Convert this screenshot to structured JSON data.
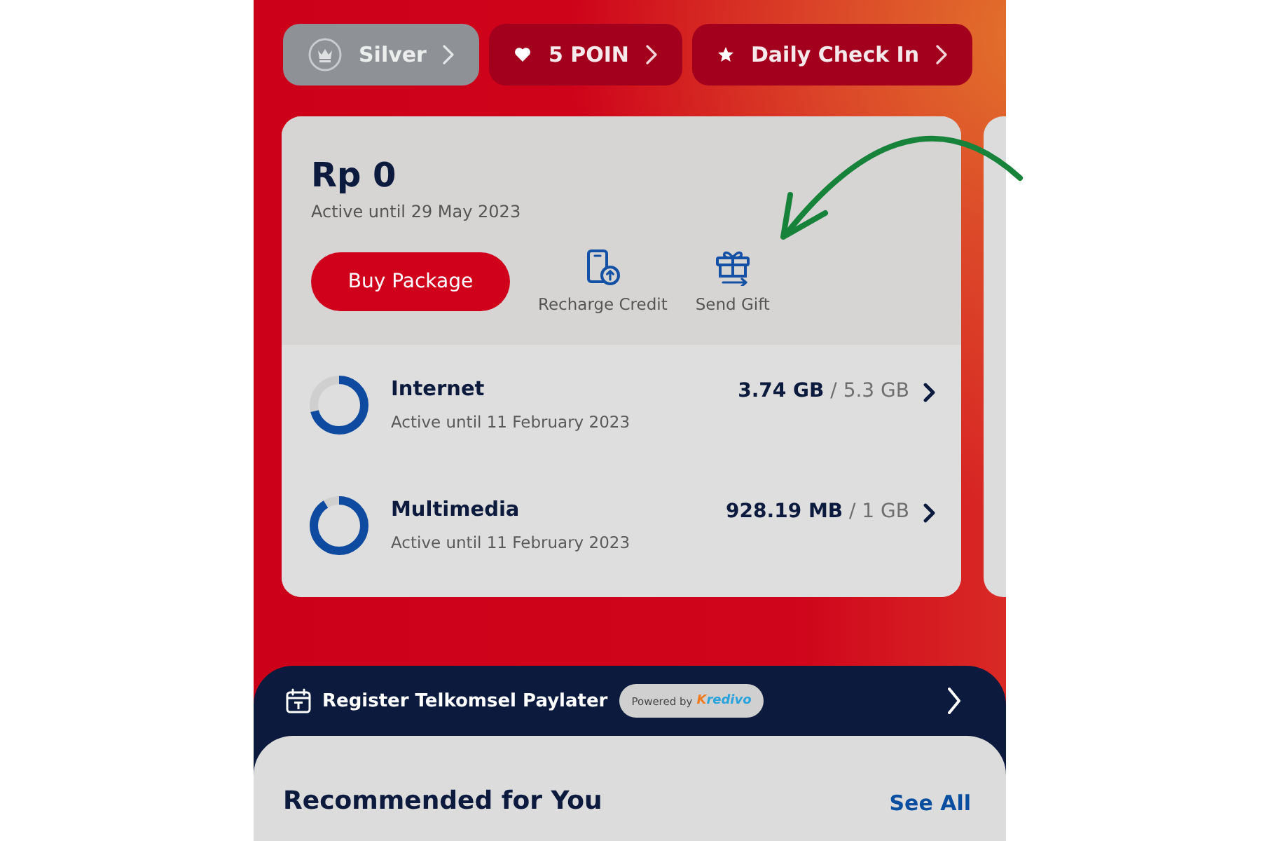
{
  "header_chips": [
    {
      "kind": "tier",
      "label": "Silver"
    },
    {
      "kind": "points",
      "label": "5 POIN"
    },
    {
      "kind": "checkin",
      "label": "Daily Check In"
    }
  ],
  "account_card": {
    "balance": "Rp 0",
    "validity": "Active until 29 May 2023",
    "primary_button": "Buy Package",
    "actions": [
      {
        "kind": "recharge",
        "label": "Recharge Credit"
      },
      {
        "kind": "gift",
        "label": "Send Gift"
      }
    ],
    "quotas": [
      {
        "name": "Internet",
        "validity": "Active until 11 February 2023",
        "usage": "**3.74 GB** / 5.3 GB",
        "level": 0.71
      },
      {
        "name": "Multimedia",
        "validity": "Active until 11 February 2023",
        "usage": "**928.19 MB** / 1 GB",
        "level": 0.91
      }
    ]
  },
  "paylater_banner": {
    "label": "Register Telkomsel Paylater",
    "powered_by": "Powered by",
    "partner": "Kredivo"
  },
  "recommendations": {
    "title": "Recommended for You",
    "link": "See All"
  }
}
